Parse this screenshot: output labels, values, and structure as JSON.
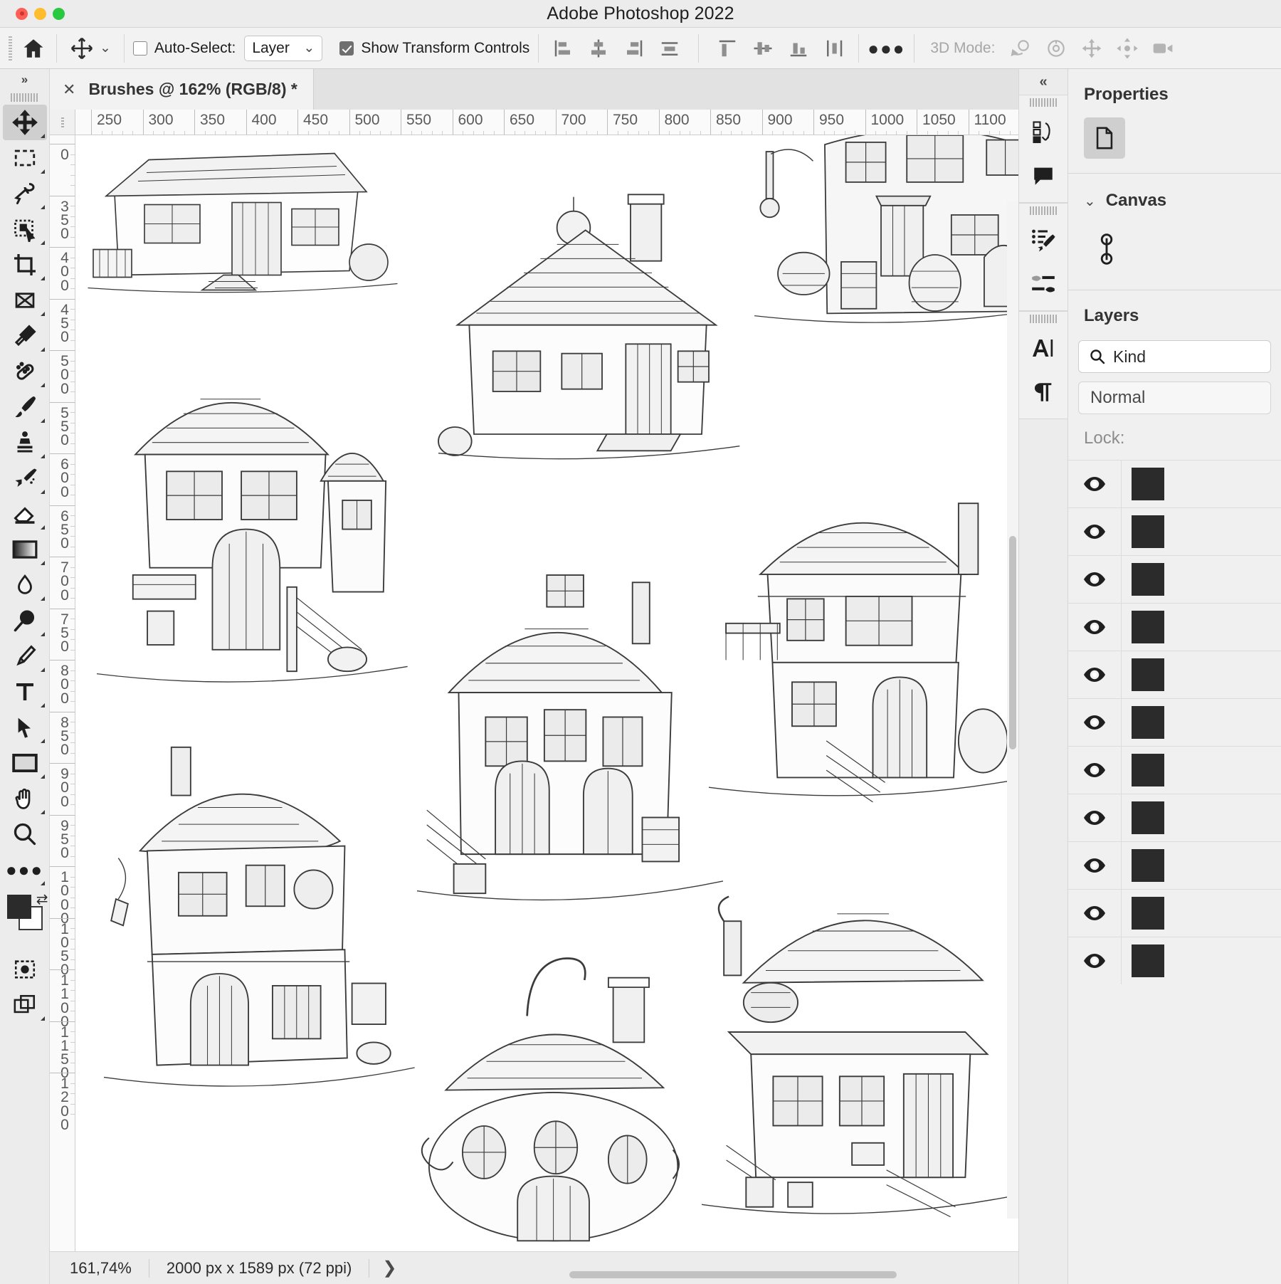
{
  "window": {
    "title": "Adobe Photoshop 2022",
    "traffic_lights": [
      "close",
      "minimize",
      "zoom"
    ]
  },
  "options_bar": {
    "home_icon": "home-icon",
    "tool_icon": "move-tool-icon",
    "tool_dropdown_icon": "chevron-down-icon",
    "auto_select_checked": false,
    "auto_select_label": "Auto-Select:",
    "auto_select_value": "Layer",
    "auto_select_caret": "chevron-down-icon",
    "show_transform_checked": true,
    "show_transform_label": "Show Transform Controls",
    "align_icons": [
      "align-left-edges-icon",
      "align-horizontal-centers-icon",
      "align-right-edges-icon",
      "distribute-horizontal-icon",
      "align-top-edges-icon",
      "align-vertical-centers-icon",
      "align-bottom-edges-icon",
      "distribute-vertical-icon"
    ],
    "more_icon": "ellipsis-icon",
    "three_d_label": "3D Mode:",
    "three_d_icons": [
      "orbit-3d-icon",
      "roll-3d-icon",
      "pan-3d-icon",
      "slide-3d-icon",
      "camera-3d-icon"
    ]
  },
  "toolbar": {
    "expand_label": "»",
    "tools": [
      {
        "name": "move-tool",
        "icon": "move-icon",
        "active": true,
        "has_flyout": true
      },
      {
        "name": "rectangular-marquee-tool",
        "icon": "marquee-icon",
        "active": false,
        "has_flyout": true
      },
      {
        "name": "lasso-tool",
        "icon": "lasso-icon",
        "active": false,
        "has_flyout": true
      },
      {
        "name": "object-selection-tool",
        "icon": "quick-select-icon",
        "active": false,
        "has_flyout": true
      },
      {
        "name": "crop-tool",
        "icon": "crop-icon",
        "active": false,
        "has_flyout": true
      },
      {
        "name": "frame-tool",
        "icon": "frame-icon",
        "active": false,
        "has_flyout": false
      },
      {
        "name": "eyedropper-tool",
        "icon": "eyedropper-icon",
        "active": false,
        "has_flyout": true
      },
      {
        "name": "spot-healing-brush-tool",
        "icon": "healing-icon",
        "active": false,
        "has_flyout": true
      },
      {
        "name": "brush-tool",
        "icon": "brush-icon",
        "active": false,
        "has_flyout": true
      },
      {
        "name": "clone-stamp-tool",
        "icon": "stamp-icon",
        "active": false,
        "has_flyout": true
      },
      {
        "name": "history-brush-tool",
        "icon": "history-brush-icon",
        "active": false,
        "has_flyout": true
      },
      {
        "name": "eraser-tool",
        "icon": "eraser-icon",
        "active": false,
        "has_flyout": true
      },
      {
        "name": "gradient-tool",
        "icon": "gradient-icon",
        "active": false,
        "has_flyout": true
      },
      {
        "name": "blur-tool",
        "icon": "blur-drop-icon",
        "active": false,
        "has_flyout": true
      },
      {
        "name": "dodge-tool",
        "icon": "dodge-icon",
        "active": false,
        "has_flyout": true
      },
      {
        "name": "pen-tool",
        "icon": "pen-icon",
        "active": false,
        "has_flyout": true
      },
      {
        "name": "type-tool",
        "icon": "type-icon",
        "active": false,
        "has_flyout": true
      },
      {
        "name": "path-selection-tool",
        "icon": "path-arrow-icon",
        "active": false,
        "has_flyout": true
      },
      {
        "name": "rectangle-tool",
        "icon": "rectangle-icon",
        "active": false,
        "has_flyout": true
      },
      {
        "name": "hand-tool",
        "icon": "hand-icon",
        "active": false,
        "has_flyout": true
      },
      {
        "name": "zoom-tool",
        "icon": "magnifier-icon",
        "active": false,
        "has_flyout": false
      },
      {
        "name": "edit-toolbar",
        "icon": "ellipsis-icon",
        "active": false,
        "has_flyout": true
      }
    ],
    "swap_colors_icon": "swap-arrows-icon",
    "quick_mask_icon": "quick-mask-icon",
    "screen_mode_icon": "screen-mode-icon",
    "foreground_color": "#2b2b2b",
    "background_color": "#ffffff"
  },
  "document": {
    "tab_close_icon": "close-icon",
    "tab_title": "Brushes @ 162% (RGB/8) *",
    "h_ruler_ticks": [
      "250",
      "300",
      "350",
      "400",
      "450",
      "500",
      "550",
      "600",
      "650",
      "700",
      "750",
      "800",
      "850",
      "900",
      "950",
      "1000",
      "1050",
      "1100"
    ],
    "v_ruler_ticks": [
      "0",
      "350",
      "400",
      "450",
      "500",
      "550",
      "600",
      "650",
      "700",
      "750",
      "800",
      "850",
      "900",
      "950",
      "1000",
      "1050",
      "1100",
      "1150",
      "1200"
    ],
    "canvas_description": "Grid of pencil-sketch fantasy cottage illustrations on white background"
  },
  "status_bar": {
    "zoom_level": "161,74%",
    "doc_size": "2000 px x 1589 px (72 ppi)",
    "expand_icon": "chevron-right-icon"
  },
  "right_rail": {
    "collapse_icon": "double-chevron-left-icon",
    "groups": [
      {
        "icons": [
          "history-states-icon",
          "comments-icon"
        ]
      },
      {
        "icons": [
          "brush-settings-icon",
          "brushes-icon"
        ]
      },
      {
        "icons": [
          "character-icon",
          "paragraph-icon"
        ]
      }
    ]
  },
  "properties_panel": {
    "title": "Properties",
    "doc_mode_icon": "document-icon",
    "section_caret": "chevron-down-icon",
    "section_label": "Canvas",
    "link_icon": "link-icon"
  },
  "layers_panel": {
    "title": "Layers",
    "search_icon": "search-icon",
    "search_value": "Kind",
    "blend_mode": "Normal",
    "lock_label": "Lock:",
    "rows": [
      {
        "visible_icon": "eye-icon"
      },
      {
        "visible_icon": "eye-icon"
      },
      {
        "visible_icon": "eye-icon"
      },
      {
        "visible_icon": "eye-icon"
      },
      {
        "visible_icon": "eye-icon"
      },
      {
        "visible_icon": "eye-icon"
      },
      {
        "visible_icon": "eye-icon"
      },
      {
        "visible_icon": "eye-icon"
      },
      {
        "visible_icon": "eye-icon"
      },
      {
        "visible_icon": "eye-icon"
      },
      {
        "visible_icon": "eye-icon"
      }
    ]
  }
}
